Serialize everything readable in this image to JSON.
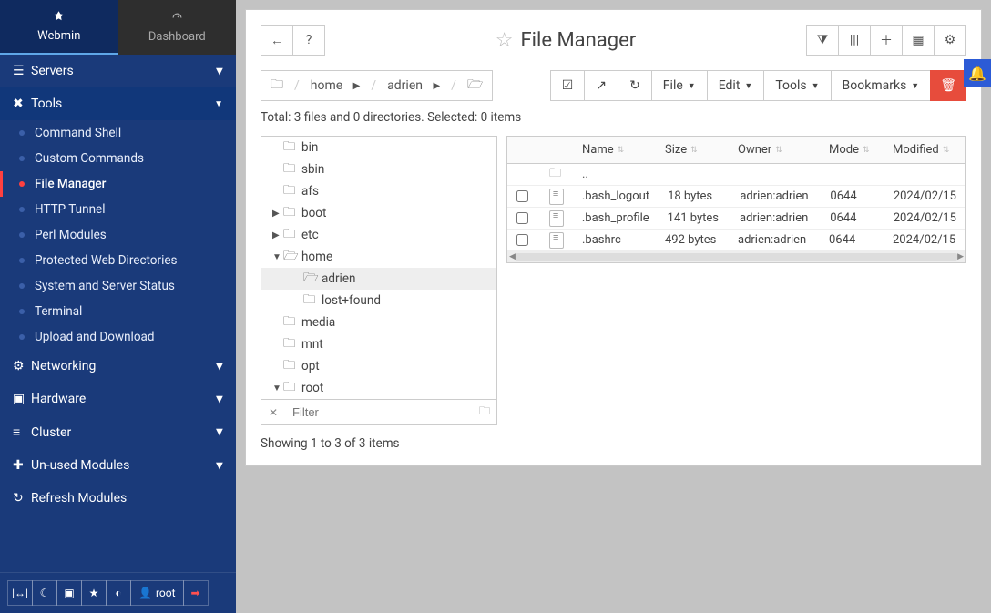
{
  "sidebar": {
    "tabs": [
      {
        "id": "webmin",
        "label": "Webmin",
        "active": true
      },
      {
        "id": "dashboard",
        "label": "Dashboard",
        "active": false
      }
    ],
    "sections": {
      "servers": "Servers",
      "tools": "Tools",
      "networking": "Networking",
      "hardware": "Hardware",
      "cluster": "Cluster",
      "unused": "Un-used Modules",
      "refresh": "Refresh Modules"
    },
    "tools_items": [
      "Command Shell",
      "Custom Commands",
      "File Manager",
      "HTTP Tunnel",
      "Perl Modules",
      "Protected Web Directories",
      "System and Server Status",
      "Terminal",
      "Upload and Download"
    ],
    "active_tool_index": 2,
    "user_label": "root"
  },
  "page": {
    "title": "File Manager",
    "breadcrumb": [
      "home",
      "adrien"
    ],
    "menus": {
      "file": "File",
      "edit": "Edit",
      "tools": "Tools",
      "bookmarks": "Bookmarks"
    },
    "status": "Total: 3 files and 0 directories. Selected: 0 items",
    "showing": "Showing 1 to 3 of 3 items",
    "filter_placeholder": "Filter"
  },
  "tree": [
    {
      "name": "bin",
      "depth": 0,
      "expand": ""
    },
    {
      "name": "sbin",
      "depth": 0,
      "expand": ""
    },
    {
      "name": "afs",
      "depth": 0,
      "expand": ""
    },
    {
      "name": "boot",
      "depth": 0,
      "expand": "▶"
    },
    {
      "name": "etc",
      "depth": 0,
      "expand": "▶"
    },
    {
      "name": "home",
      "depth": 0,
      "expand": "▼",
      "open": true
    },
    {
      "name": "adrien",
      "depth": 1,
      "expand": "",
      "open": true,
      "selected": true
    },
    {
      "name": "lost+found",
      "depth": 1,
      "expand": ""
    },
    {
      "name": "media",
      "depth": 0,
      "expand": ""
    },
    {
      "name": "mnt",
      "depth": 0,
      "expand": ""
    },
    {
      "name": "opt",
      "depth": 0,
      "expand": ""
    },
    {
      "name": "root",
      "depth": 0,
      "expand": "▼"
    }
  ],
  "table": {
    "headers": {
      "name": "Name",
      "size": "Size",
      "owner": "Owner",
      "mode": "Mode",
      "modified": "Modified"
    },
    "parent": "..",
    "rows": [
      {
        "name": ".bash_logout",
        "size": "18 bytes",
        "owner": "adrien:adrien",
        "mode": "0644",
        "modified": "2024/02/15"
      },
      {
        "name": ".bash_profile",
        "size": "141 bytes",
        "owner": "adrien:adrien",
        "mode": "0644",
        "modified": "2024/02/15"
      },
      {
        "name": ".bashrc",
        "size": "492 bytes",
        "owner": "adrien:adrien",
        "mode": "0644",
        "modified": "2024/02/15"
      }
    ]
  }
}
